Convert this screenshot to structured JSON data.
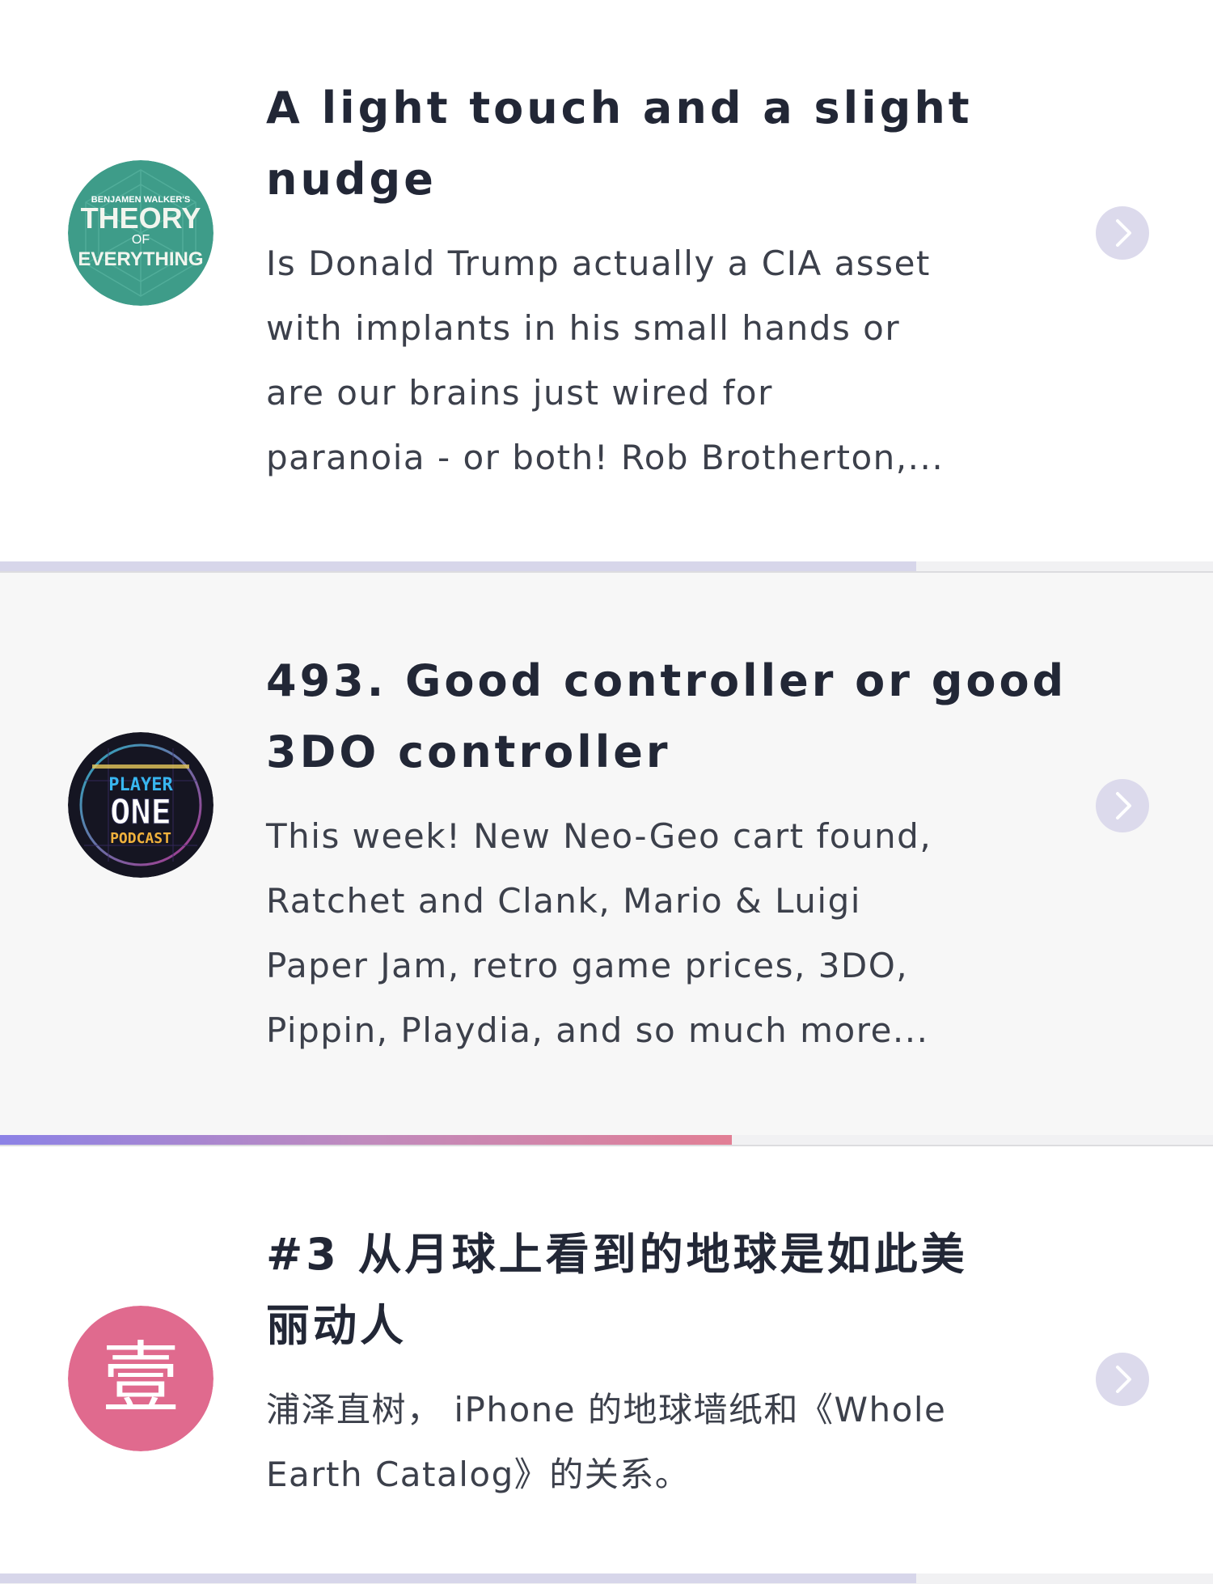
{
  "episodes": [
    {
      "podcast": {
        "line1": "BENJAMEN WALKER'S",
        "line2": "THEORY",
        "line3": "OF",
        "line4": "EVERYTHING",
        "bg": "#3e9c89"
      },
      "title_lines": [
        "A light touch and a slight",
        "nudge"
      ],
      "desc_lines": [
        "Is Donald Trump actually a CIA asset",
        "with implants in his small hands or",
        "are our brains just wired for",
        "paranoia - or both! Rob Brotherton,..."
      ],
      "progress": 0.755,
      "progress_style": "muted"
    },
    {
      "podcast": {
        "line1": "PLAYER",
        "line2": "ONE",
        "line3": "PODCAST",
        "bg": "#151522"
      },
      "title_lines": [
        "493. Good controller or good",
        "3DO controller"
      ],
      "desc_lines": [
        "This week! New Neo-Geo cart found,",
        "Ratchet and Clank, Mario & Luigi",
        "Paper Jam, retro game prices, 3DO,",
        "Pippin, Playdia, and so much more..."
      ],
      "progress": 0.603,
      "progress_style": "gradient"
    },
    {
      "podcast": {
        "glyph": "壹",
        "bg": "#e06a8e"
      },
      "title_lines": [
        "#3 从月球上看到的地球是如此美",
        "丽动人"
      ],
      "desc_lines": [
        "浦泽直树， iPhone 的地球墙纸和《Whole",
        "Earth Catalog》的关系。"
      ],
      "progress": 0.755,
      "progress_style": "muted"
    }
  ],
  "colors": {
    "title": "#222736",
    "description": "#3c404b",
    "chevron_bg": "#dcdaec",
    "chevron_stroke": "#ffffff"
  },
  "icons": {
    "chevron": "chevron-right-icon"
  }
}
